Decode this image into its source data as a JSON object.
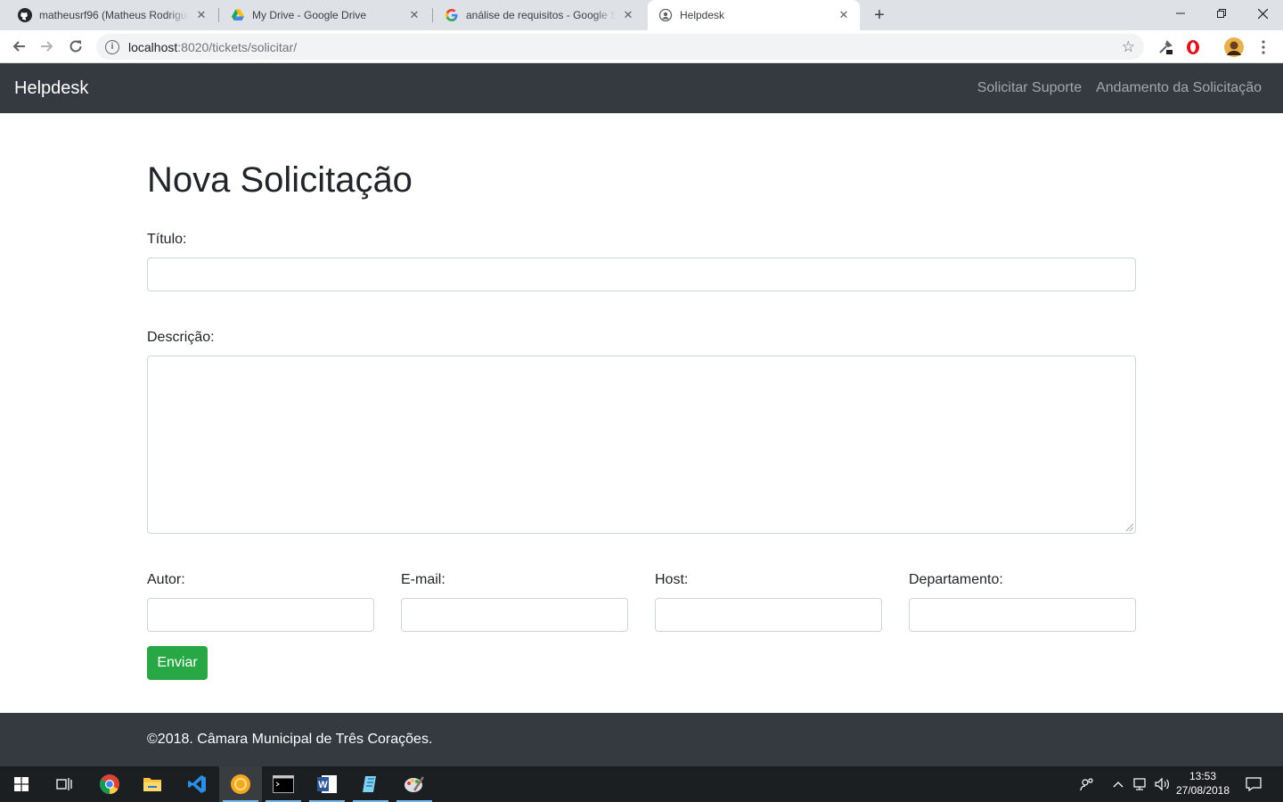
{
  "browser": {
    "tabs": [
      {
        "title": "matheusrf96 (Matheus Rodrigues",
        "favicon": "github-icon"
      },
      {
        "title": "My Drive - Google Drive",
        "favicon": "google-drive-icon"
      },
      {
        "title": "análise de requisitos - Google Se",
        "favicon": "google-icon"
      },
      {
        "title": "Helpdesk",
        "favicon": "globe-icon"
      }
    ],
    "active_tab": 3,
    "url_host": "localhost",
    "url_path": ":8020/tickets/solicitar/"
  },
  "navbar": {
    "brand": "Helpdesk",
    "links": [
      "Solicitar Suporte",
      "Andamento da Solicitação"
    ]
  },
  "form": {
    "title": "Nova Solicitação",
    "titulo_label": "Título:",
    "descricao_label": "Descrição:",
    "autor_label": "Autor:",
    "email_label": "E-mail:",
    "host_label": "Host:",
    "departamento_label": "Departamento:",
    "submit_label": "Enviar"
  },
  "footer": {
    "text": "©2018. Câmara Municipal de Três Corações."
  },
  "taskbar": {
    "time": "13:53",
    "date": "27/08/2018"
  },
  "colors": {
    "navbar_bg": "#343a40",
    "success": "#28a745",
    "chrome_tabstrip": "#dee1e6"
  }
}
